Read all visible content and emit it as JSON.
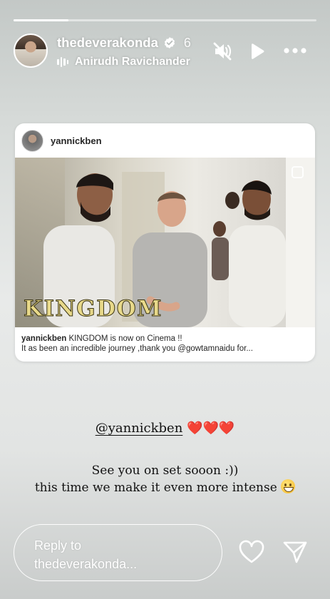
{
  "story": {
    "progress": 0.18,
    "username": "thedeverakonda",
    "time_ago": "6",
    "music": "Anirudh Ravichander",
    "icons": {
      "verified": "verified-badge-icon",
      "music": "music-bars-icon",
      "mute": "mute-icon",
      "play": "play-icon",
      "more": "more-icon"
    }
  },
  "shared_post": {
    "username": "yannickben",
    "overlay_title": "KINGDOM",
    "caption_user": "yannickben",
    "caption_line1": " KINGDOM is now on Cinema !!",
    "caption_line2": "It as been an incredible journey ,thank you @gowtamnaidu for..."
  },
  "text_overlay": {
    "mention": "@yannickben",
    "hearts": "❤️❤️❤️",
    "line1": "See you on set sooon :))",
    "line2": "this time we make it even more intense"
  },
  "reply": {
    "placeholder_line1": "Reply to",
    "placeholder_line2": "thedeverakonda..."
  },
  "colors": {
    "heart_red": "#e0162b",
    "text_dark": "#111111"
  }
}
